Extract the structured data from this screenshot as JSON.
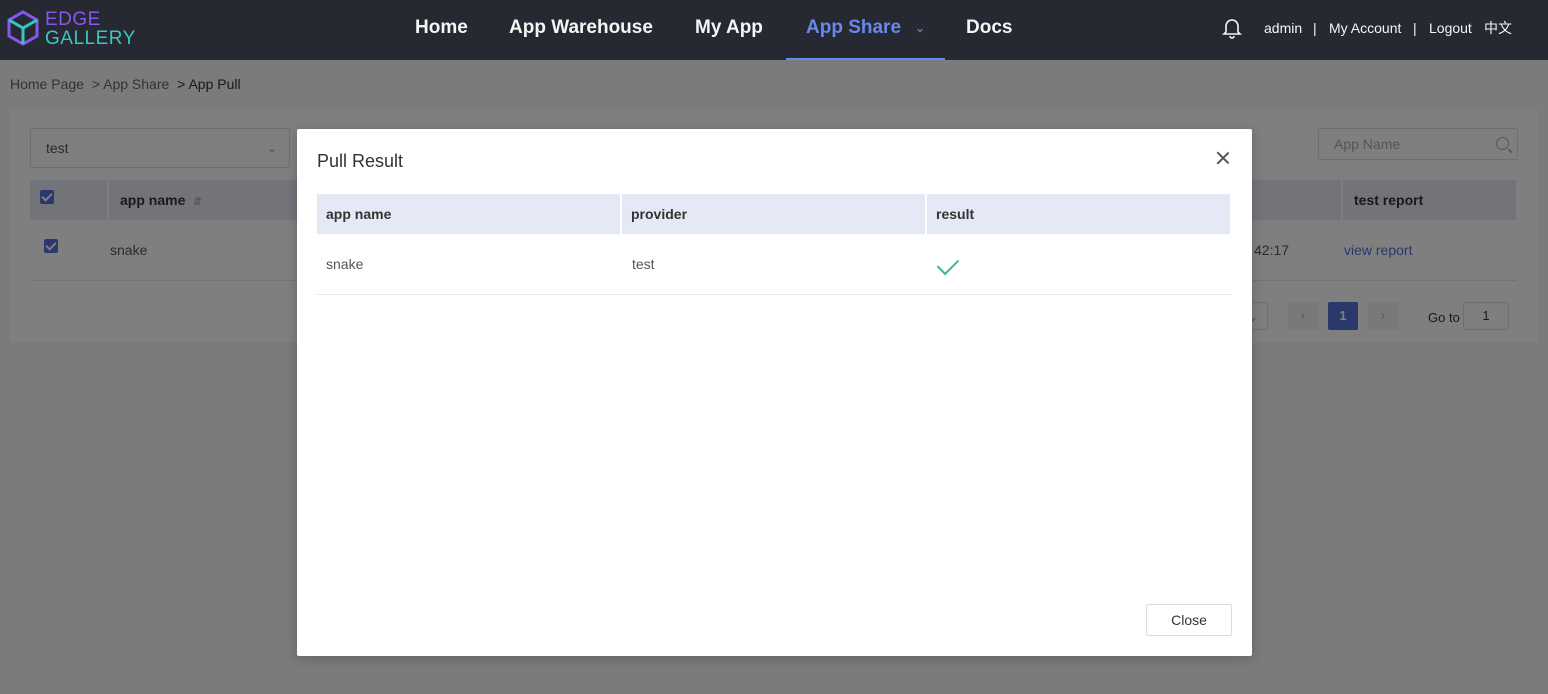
{
  "brand": {
    "line1": "EDGE",
    "line2": "GALLERY"
  },
  "nav": {
    "items": [
      {
        "label": "Home"
      },
      {
        "label": "App Warehouse"
      },
      {
        "label": "My App"
      },
      {
        "label": "App Share",
        "active": true
      },
      {
        "label": "Docs"
      }
    ]
  },
  "user_menu": {
    "username": "admin",
    "separator": "|",
    "account": "My Account",
    "logout": "Logout",
    "language": "中文"
  },
  "breadcrumb": {
    "home": "Home Page",
    "section": "> App Share",
    "current": "> App Pull"
  },
  "filter": {
    "selected": "test",
    "search_placeholder": "App Name"
  },
  "background_table": {
    "headers": {
      "app_name": "app name",
      "test_report": "test report"
    },
    "rows": [
      {
        "app_name": "snake",
        "time_fragment": "42:17",
        "report_link": "view report"
      }
    ]
  },
  "pagination": {
    "current_page": "1",
    "goto_label": "Go to",
    "goto_value": "1"
  },
  "dialog": {
    "title": "Pull Result",
    "columns": [
      "app name",
      "provider",
      "result"
    ],
    "rows": [
      {
        "app_name": "snake",
        "provider": "test",
        "result": "success"
      }
    ],
    "close_label": "Close"
  },
  "colors": {
    "header_bg": "#282b33",
    "accent": "#6d8ef7",
    "brand_purple": "#8a5cf5",
    "brand_teal": "#39d0c8",
    "success": "#3cba8a",
    "table_header_bg": "#e4e9f5"
  }
}
